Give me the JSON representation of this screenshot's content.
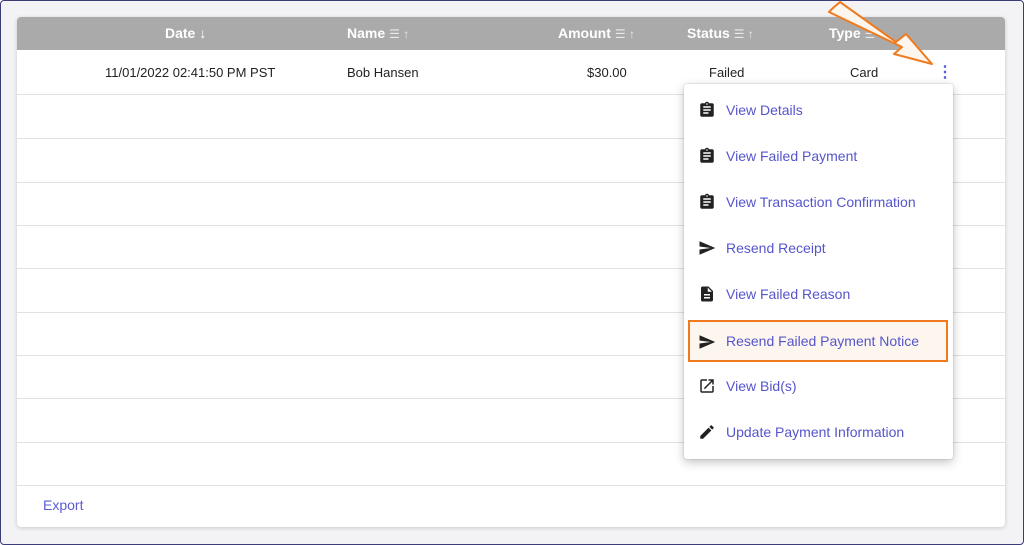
{
  "table": {
    "columns": [
      {
        "label": "Date",
        "sort_icon": "arrow-down-icon"
      },
      {
        "label": "Name",
        "sort_icon": "filter-sort-icon"
      },
      {
        "label": "Amount",
        "sort_icon": "filter-sort-icon"
      },
      {
        "label": "Status",
        "sort_icon": "filter-sort-icon"
      },
      {
        "label": "Type",
        "sort_icon": "filter-sort-icon"
      }
    ],
    "rows": [
      {
        "date": "11/01/2022 02:41:50 PM PST",
        "name": "Bob Hansen",
        "amount": "$30.00",
        "status": "Failed",
        "type": "Card"
      }
    ],
    "export_label": "Export"
  },
  "menu": {
    "items": [
      {
        "label": "View Details",
        "icon": "clipboard-icon"
      },
      {
        "label": "View Failed Payment",
        "icon": "clipboard-icon"
      },
      {
        "label": "View Transaction Confirmation",
        "icon": "clipboard-icon"
      },
      {
        "label": "Resend Receipt",
        "icon": "send-icon"
      },
      {
        "label": "View Failed Reason",
        "icon": "document-icon"
      },
      {
        "label": "Resend Failed Payment Notice",
        "icon": "send-icon",
        "highlighted": true
      },
      {
        "label": "View Bid(s)",
        "icon": "open-external-icon"
      },
      {
        "label": "Update Payment Information",
        "icon": "pencil-icon"
      }
    ]
  },
  "colors": {
    "header_bg": "#aaaaaa",
    "link": "#5555cc",
    "highlight_border": "#f07a1e",
    "annotation_arrow": "#f07a1e"
  }
}
